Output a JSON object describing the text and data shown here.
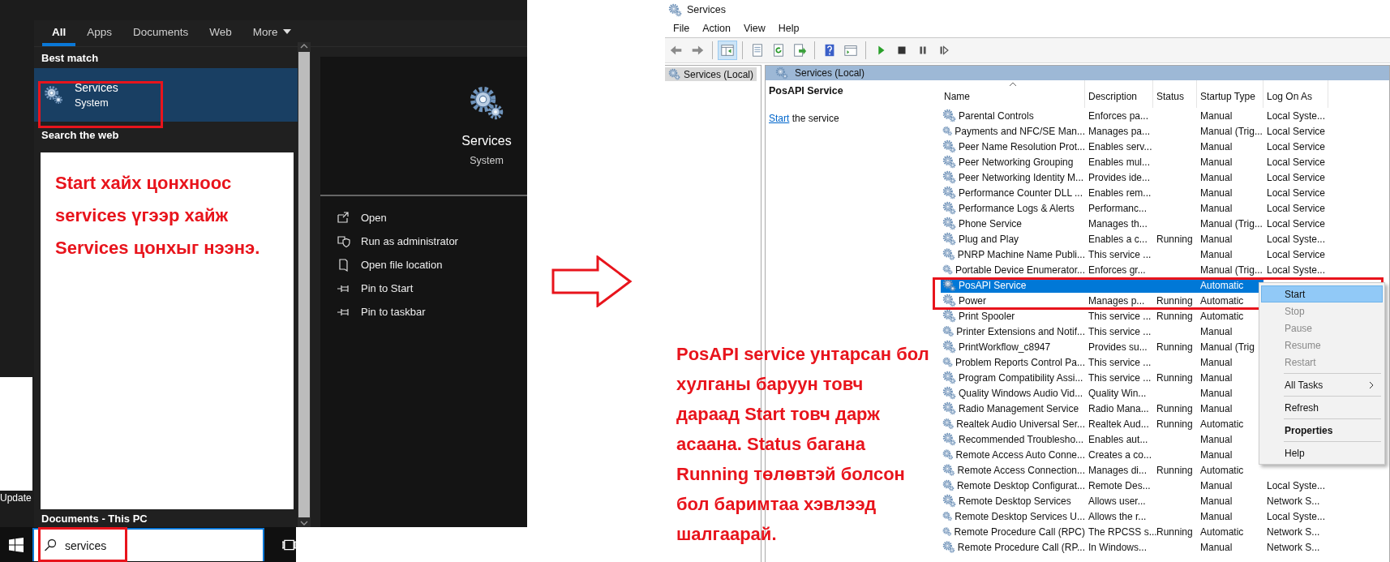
{
  "desktop": {
    "icon_label": "Update"
  },
  "search_panel": {
    "tabs": [
      {
        "label": "All",
        "selected": true,
        "dropdown": false
      },
      {
        "label": "Apps",
        "selected": false,
        "dropdown": false
      },
      {
        "label": "Documents",
        "selected": false,
        "dropdown": false
      },
      {
        "label": "Web",
        "selected": false,
        "dropdown": false
      },
      {
        "label": "More",
        "selected": false,
        "dropdown": true
      }
    ],
    "best_match_heading": "Best match",
    "best_match": {
      "title": "Services",
      "subtitle": "System",
      "selected": true
    },
    "web_heading": "Search the web",
    "note": "Start хайх цонхноос services үгээр хайж Services цонхыг нээнэ.",
    "documents_heading": "Documents - This PC",
    "preview": {
      "title": "Services",
      "subtitle": "System"
    },
    "actions": [
      {
        "label": "Open",
        "kind": "open"
      },
      {
        "label": "Run as administrator",
        "kind": "shield"
      },
      {
        "label": "Open file location",
        "kind": "folder"
      },
      {
        "label": "Pin to Start",
        "kind": "pin"
      },
      {
        "label": "Pin to taskbar",
        "kind": "pin"
      }
    ],
    "search_field": {
      "value": "services"
    }
  },
  "services_window": {
    "title": "Services",
    "menu": [
      "File",
      "Action",
      "View",
      "Help"
    ],
    "toolbar": [
      {
        "kind": "back",
        "pressed": false
      },
      {
        "kind": "forward",
        "pressed": false
      },
      {
        "kind": "tree",
        "pressed": true
      },
      {
        "kind": "properties",
        "pressed": false
      },
      {
        "kind": "refresh",
        "pressed": false
      },
      {
        "kind": "export",
        "pressed": false
      },
      {
        "kind": "help",
        "pressed": false
      },
      {
        "kind": "view",
        "pressed": false
      },
      {
        "kind": "play",
        "pressed": false
      },
      {
        "kind": "stop",
        "pressed": false
      },
      {
        "kind": "pause",
        "pressed": false
      },
      {
        "kind": "resume",
        "pressed": false
      }
    ],
    "tree": [
      {
        "label": "Services (Local)",
        "selected": true
      }
    ],
    "header": "Services (Local)",
    "detail": {
      "title": "PosAPI Service",
      "link": "Start",
      "text": "the service"
    },
    "columns": [
      {
        "label": "Name",
        "sorted": true
      },
      {
        "label": "Description",
        "sorted": false
      },
      {
        "label": "Status",
        "sorted": false
      },
      {
        "label": "Startup Type",
        "sorted": false
      },
      {
        "label": "Log On As",
        "sorted": false
      }
    ],
    "rows": [
      {
        "name": "Parental Controls",
        "description": "Enforces pa...",
        "startup": "Manual",
        "log_on": "Local Syste...",
        "selected": false
      },
      {
        "name": "Payments and NFC/SE Man...",
        "description": "Manages pa...",
        "startup": "Manual (Trig...",
        "log_on": "Local Service",
        "selected": false
      },
      {
        "name": "Peer Name Resolution Prot...",
        "description": "Enables serv...",
        "startup": "Manual",
        "log_on": "Local Service",
        "selected": false
      },
      {
        "name": "Peer Networking Grouping",
        "description": "Enables mul...",
        "startup": "Manual",
        "log_on": "Local Service",
        "selected": false
      },
      {
        "name": "Peer Networking Identity M...",
        "description": "Provides ide...",
        "startup": "Manual",
        "log_on": "Local Service",
        "selected": false
      },
      {
        "name": "Performance Counter DLL ...",
        "description": "Enables rem...",
        "startup": "Manual",
        "log_on": "Local Service",
        "selected": false
      },
      {
        "name": "Performance Logs & Alerts",
        "description": "Performanc...",
        "startup": "Manual",
        "log_on": "Local Service",
        "selected": false
      },
      {
        "name": "Phone Service",
        "description": "Manages th...",
        "startup": "Manual (Trig...",
        "log_on": "Local Service",
        "selected": false
      },
      {
        "name": "Plug and Play",
        "description": "Enables a c...",
        "status": "Running",
        "startup": "Manual",
        "log_on": "Local Syste...",
        "selected": false
      },
      {
        "name": "PNRP Machine Name Publi...",
        "description": "This service ...",
        "startup": "Manual",
        "log_on": "Local Service",
        "selected": false
      },
      {
        "name": "Portable Device Enumerator...",
        "description": "Enforces gr...",
        "startup": "Manual (Trig...",
        "log_on": "Local Syste...",
        "selected": false
      },
      {
        "name": "PosAPI Service",
        "startup": "Automatic",
        "selected": true
      },
      {
        "name": "Power",
        "description": "Manages p...",
        "status": "Running",
        "startup": "Automatic",
        "selected": false
      },
      {
        "name": "Print Spooler",
        "description": "This service ...",
        "status": "Running",
        "startup": "Automatic",
        "selected": false
      },
      {
        "name": "Printer Extensions and Notif...",
        "description": "This service ...",
        "startup": "Manual",
        "selected": false
      },
      {
        "name": "PrintWorkflow_c8947",
        "description": "Provides su...",
        "status": "Running",
        "startup": "Manual (Trig",
        "selected": false
      },
      {
        "name": "Problem Reports Control Pa...",
        "description": "This service ...",
        "startup": "Manual",
        "selected": false
      },
      {
        "name": "Program Compatibility Assi...",
        "description": "This service ...",
        "status": "Running",
        "startup": "Manual",
        "selected": false
      },
      {
        "name": "Quality Windows Audio Vid...",
        "description": "Quality Win...",
        "startup": "Manual",
        "selected": false
      },
      {
        "name": "Radio Management Service",
        "description": "Radio Mana...",
        "status": "Running",
        "startup": "Manual",
        "selected": false
      },
      {
        "name": "Realtek Audio Universal Ser...",
        "description": "Realtek Aud...",
        "status": "Running",
        "startup": "Automatic",
        "selected": false
      },
      {
        "name": "Recommended Troublesho...",
        "description": "Enables aut...",
        "startup": "Manual",
        "selected": false
      },
      {
        "name": "Remote Access Auto Conne...",
        "description": "Creates a co...",
        "startup": "Manual",
        "selected": false
      },
      {
        "name": "Remote Access Connection...",
        "description": "Manages di...",
        "status": "Running",
        "startup": "Automatic",
        "selected": false
      },
      {
        "name": "Remote Desktop Configurat...",
        "description": "Remote Des...",
        "startup": "Manual",
        "log_on": "Local Syste...",
        "selected": false
      },
      {
        "name": "Remote Desktop Services",
        "description": "Allows user...",
        "startup": "Manual",
        "log_on": "Network S...",
        "selected": false
      },
      {
        "name": "Remote Desktop Services U...",
        "description": "Allows the r...",
        "startup": "Manual",
        "log_on": "Local Syste...",
        "selected": false
      },
      {
        "name": "Remote Procedure Call (RPC)",
        "description": "The RPCSS s...",
        "status": "Running",
        "startup": "Automatic",
        "log_on": "Network S...",
        "selected": false
      },
      {
        "name": "Remote Procedure Call (RP...",
        "description": "In Windows...",
        "startup": "Manual",
        "log_on": "Network S...",
        "selected": false
      }
    ],
    "context_menu": [
      {
        "items": [
          {
            "label": "Start",
            "selected": true,
            "disabled": false,
            "default": false,
            "submenu": false
          },
          {
            "label": "Stop",
            "selected": false,
            "disabled": true,
            "default": false,
            "submenu": false
          },
          {
            "label": "Pause",
            "selected": false,
            "disabled": true,
            "default": false,
            "submenu": false
          },
          {
            "label": "Resume",
            "selected": false,
            "disabled": true,
            "default": false,
            "submenu": false
          },
          {
            "label": "Restart",
            "selected": false,
            "disabled": true,
            "default": false,
            "submenu": false
          }
        ]
      },
      {
        "items": [
          {
            "label": "All Tasks",
            "selected": false,
            "disabled": false,
            "default": false,
            "submenu": true
          }
        ]
      },
      {
        "items": [
          {
            "label": "Refresh",
            "selected": false,
            "disabled": false,
            "default": false,
            "submenu": false
          }
        ]
      },
      {
        "items": [
          {
            "label": "Properties",
            "selected": false,
            "disabled": false,
            "default": true,
            "submenu": false
          }
        ]
      },
      {
        "items": [
          {
            "label": "Help",
            "selected": false,
            "disabled": false,
            "default": false,
            "submenu": false
          }
        ]
      }
    ],
    "note": "PosAPI service унтарсан бол хулганы баруун товч дараад Start товч дарж асаана. Status багана Running төлөвтэй болсон бол баримтаа хэвлээд шалгаарай."
  }
}
